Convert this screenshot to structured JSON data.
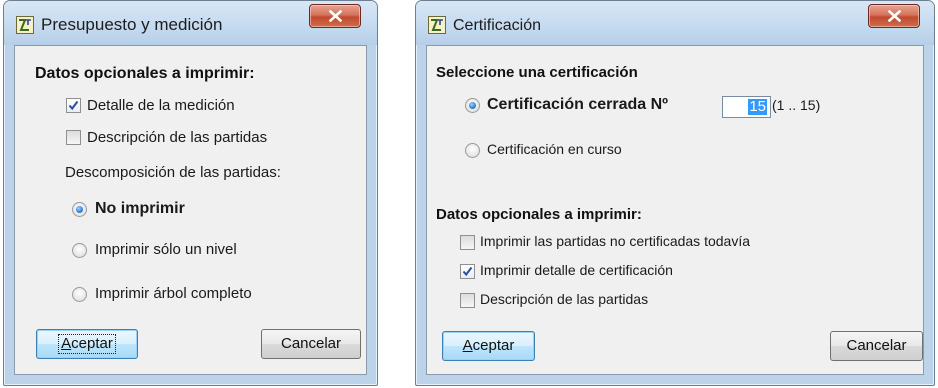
{
  "dialog1": {
    "title": "Presupuesto y medición",
    "section_title": "Datos opcionales a imprimir:",
    "checkboxes": [
      {
        "label": "Detalle de la medición",
        "checked": true
      },
      {
        "label": "Descripción de las partidas",
        "checked": false
      }
    ],
    "decomposition_label": "Descomposición de las partidas:",
    "radios": [
      {
        "label": "No imprimir",
        "selected": true
      },
      {
        "label": "Imprimir sólo un nivel",
        "selected": false
      },
      {
        "label": "Imprimir árbol completo",
        "selected": false
      }
    ],
    "ok_button": {
      "accel": "A",
      "rest": "ceptar"
    },
    "cancel_button": "Cancelar"
  },
  "dialog2": {
    "title": "Certificación",
    "select_title": "Seleccione una certificación",
    "radio_closed": {
      "label": "Certificación cerrada Nº",
      "selected": true
    },
    "certificate_number": "15",
    "range": "(1 .. 15)",
    "radio_current": {
      "label": "Certificación en curso",
      "selected": false
    },
    "optional_title": "Datos opcionales a imprimir:",
    "checkboxes": [
      {
        "label": "Imprimir las partidas no certificadas todavía",
        "checked": false
      },
      {
        "label": "Imprimir detalle de certificación",
        "checked": true
      },
      {
        "label": "Descripción de las partidas",
        "checked": false
      }
    ],
    "ok_button": {
      "accel": "A",
      "rest": "ceptar"
    },
    "cancel_button": "Cancelar"
  },
  "colors": {
    "frame": "#bcd3ea",
    "client": "#f0f0f0",
    "close_button": "#c14b2f",
    "selection": "#3399ff"
  },
  "icons": [
    "app-icon",
    "close-icon",
    "checkmark-icon"
  ]
}
